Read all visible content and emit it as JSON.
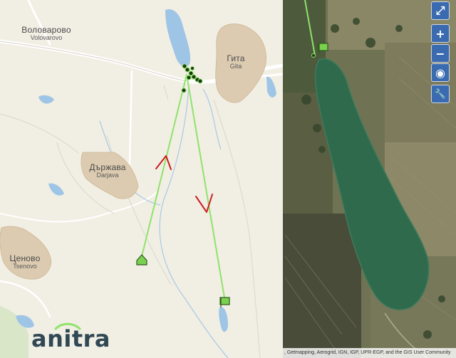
{
  "places": {
    "volovarovo": {
      "name": "Воловарово",
      "latin": "Volovarovo"
    },
    "gita": {
      "name": "Гита",
      "latin": "Gita"
    },
    "darjava": {
      "name": "Държава",
      "latin": "Darjava"
    },
    "tsenovo": {
      "name": "Ценово",
      "latin": "Tsenovo"
    }
  },
  "controls": {
    "fullscreen": "⤢",
    "zoom_in": "+",
    "zoom_out": "−",
    "locate": "◉",
    "tools": "🔧"
  },
  "attribution": ", Getmapping, Aerogrid, IGN, IGP, UPR-EGP, and the GIS User Community",
  "logo": {
    "text": "anitra"
  },
  "colors": {
    "track": "#8fe36b",
    "direction_arrow": "#cc1f1f",
    "marker": "#7ad04f",
    "map_background": "#f1eee4",
    "water": "#9ec5e6",
    "settlement": "#dccbb0",
    "control_button": "#3a6ab0",
    "satellite_lake": "#2f6a4c"
  }
}
